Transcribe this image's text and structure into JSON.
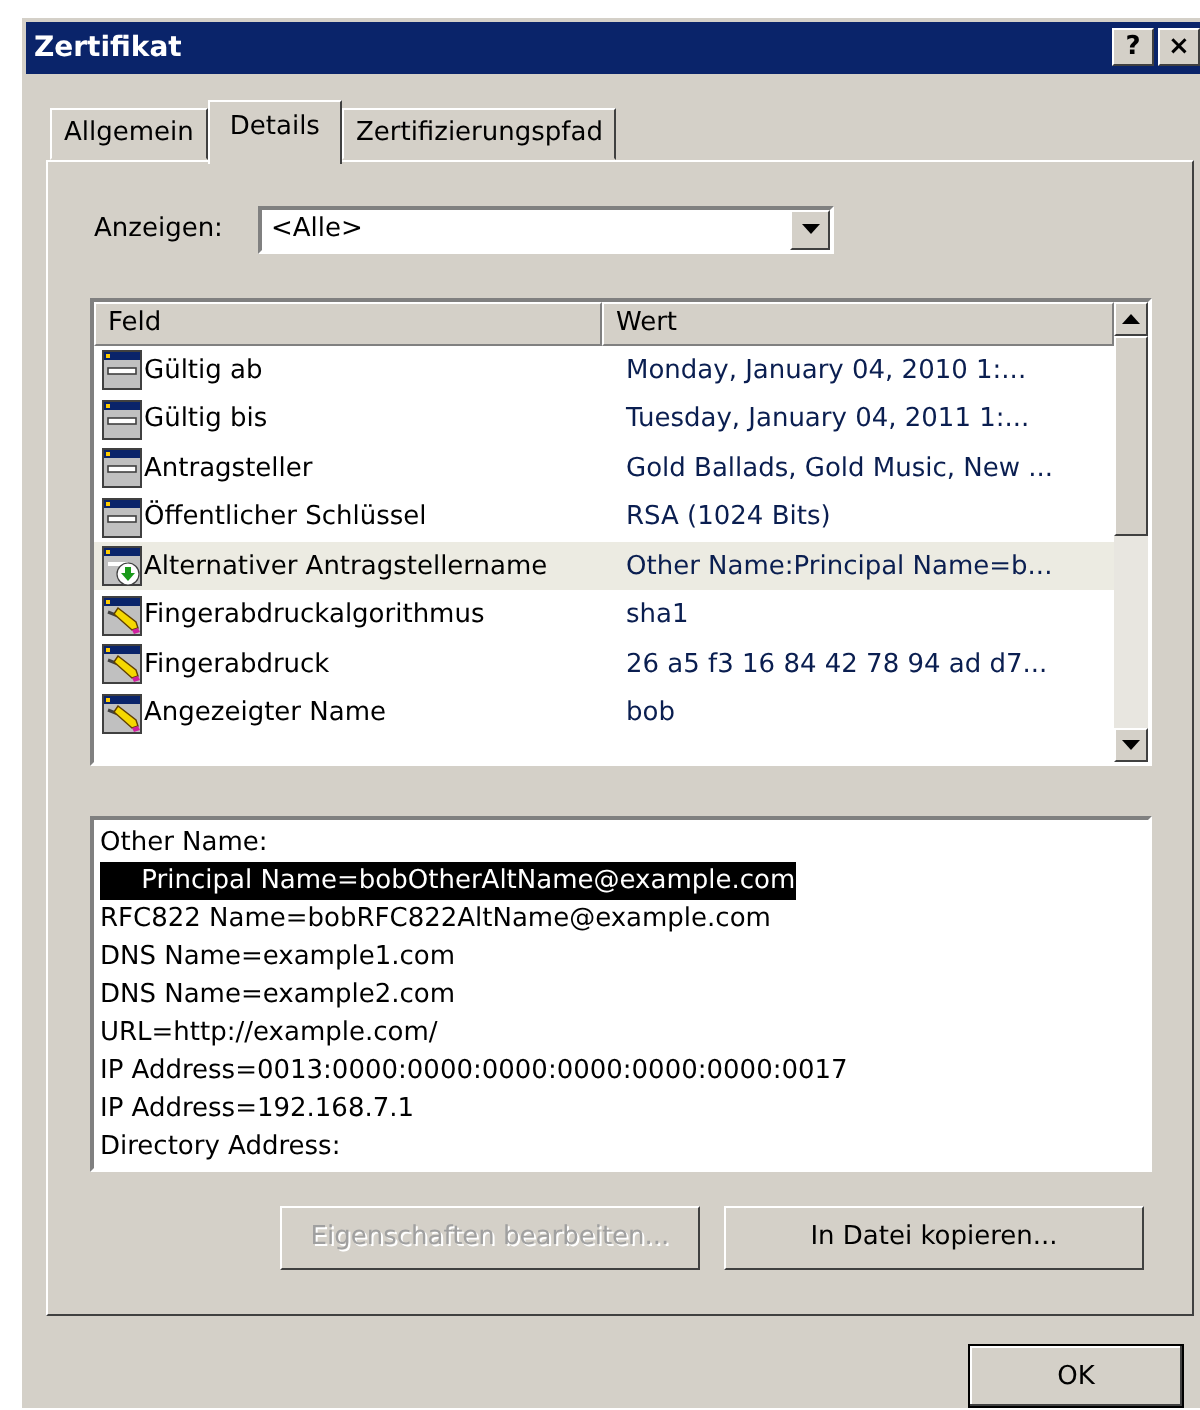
{
  "window": {
    "title": "Zertifikat",
    "title_buttons": [
      "?",
      "×"
    ]
  },
  "tabs": [
    {
      "label": "Allgemein",
      "selected": false
    },
    {
      "label": "Details",
      "selected": true
    },
    {
      "label": "Zertifizierungspfad",
      "selected": false
    }
  ],
  "show": {
    "label": "Anzeigen:",
    "value": "<Alle>"
  },
  "fields": {
    "columns": [
      "Feld",
      "Wert"
    ],
    "rows": [
      {
        "kind": "property",
        "field": "Gültig ab",
        "value": "Monday, January 04, 2010 1:...",
        "selected": false
      },
      {
        "kind": "property",
        "field": "Gültig bis",
        "value": "Tuesday, January 04, 2011 1:...",
        "selected": false
      },
      {
        "kind": "property",
        "field": "Antragsteller",
        "value": "Gold Ballads, Gold Music, New ...",
        "selected": false
      },
      {
        "kind": "property",
        "field": "Öffentlicher Schlüssel",
        "value": "RSA (1024 Bits)",
        "selected": false
      },
      {
        "kind": "extension",
        "field": "Alternativer Antragstellername",
        "value": "Other Name:Principal Name=b...",
        "selected": true
      },
      {
        "kind": "thumbprint",
        "field": "Fingerabdruckalgorithmus",
        "value": "sha1",
        "selected": false
      },
      {
        "kind": "thumbprint",
        "field": "Fingerabdruck",
        "value": "26 a5 f3 16 84 42 78 94 ad d7...",
        "selected": false
      },
      {
        "kind": "thumbprint",
        "field": "Angezeigter Name",
        "value": "bob",
        "selected": false
      }
    ]
  },
  "detail_lines": [
    {
      "text": "Other Name:",
      "selected": false
    },
    {
      "text": "     Principal Name=bobOtherAltName@example.com",
      "selected": true
    },
    {
      "text": "RFC822 Name=bobRFC822AltName@example.com",
      "selected": false
    },
    {
      "text": "DNS Name=example1.com",
      "selected": false
    },
    {
      "text": "DNS Name=example2.com",
      "selected": false
    },
    {
      "text": "URL=http://example.com/",
      "selected": false
    },
    {
      "text": "IP Address=0013:0000:0000:0000:0000:0000:0000:0017",
      "selected": false
    },
    {
      "text": "IP Address=192.168.7.1",
      "selected": false
    },
    {
      "text": "Directory Address:",
      "selected": false
    }
  ],
  "buttons": [
    {
      "label": "Eigenschaften bearbeiten...",
      "disabled": true
    },
    {
      "label": "In Datei kopieren...",
      "disabled": false
    }
  ],
  "ok": {
    "label": "OK"
  }
}
